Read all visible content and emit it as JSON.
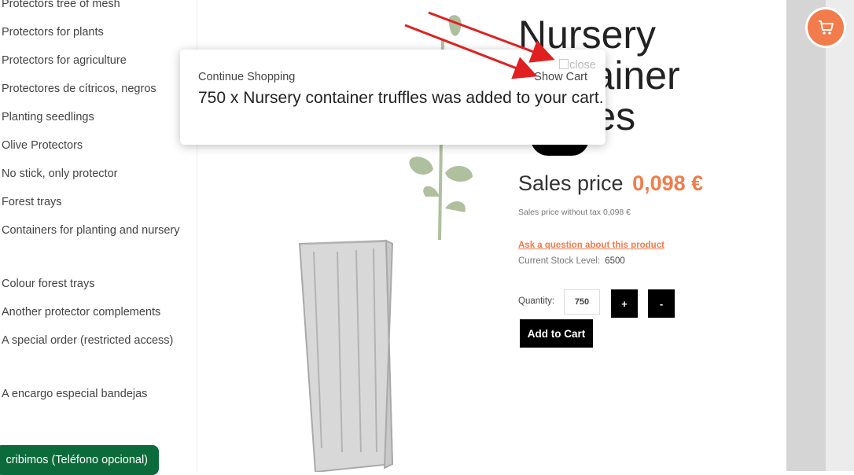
{
  "sidebar": {
    "categories": [
      "Protectors tree of mesh",
      "Protectors for plants",
      "Protectors for agriculture",
      "Protectores de cítricos, negros",
      "Planting seedlings",
      "Olive Protectors",
      "No stick, only protector",
      "Forest trays",
      "Containers for planting and nursery",
      "Colour forest trays",
      "Another protector complements",
      "A special order (restricted access)",
      "A encargo especial bandejas"
    ],
    "whatsapp_label": "cribimos (Teléfono opcional)"
  },
  "product": {
    "title": "Nursery container truffles",
    "price_label": "Sales price",
    "price": "0,098 €",
    "price_without_tax": "Sales price without tax 0,098 €",
    "ask_question": "Ask a question about this product",
    "stock_label": "Current Stock Level:",
    "stock_value": "6500",
    "quantity_label": "Quantity:",
    "quantity_value": "750",
    "plus_label": "+",
    "minus_label": "-",
    "add_to_cart": "Add to Cart"
  },
  "popup": {
    "continue_shopping": "Continue Shopping",
    "show_cart": "Show Cart",
    "close_alt": "close",
    "message": "750 x Nursery container truffles was added to your cart."
  },
  "colors": {
    "accent": "#f27c4b",
    "whatsapp_green": "#0c6b3a",
    "arrow_red": "#e02020"
  },
  "icons": {
    "cart_fab": "shopping-cart-icon"
  }
}
